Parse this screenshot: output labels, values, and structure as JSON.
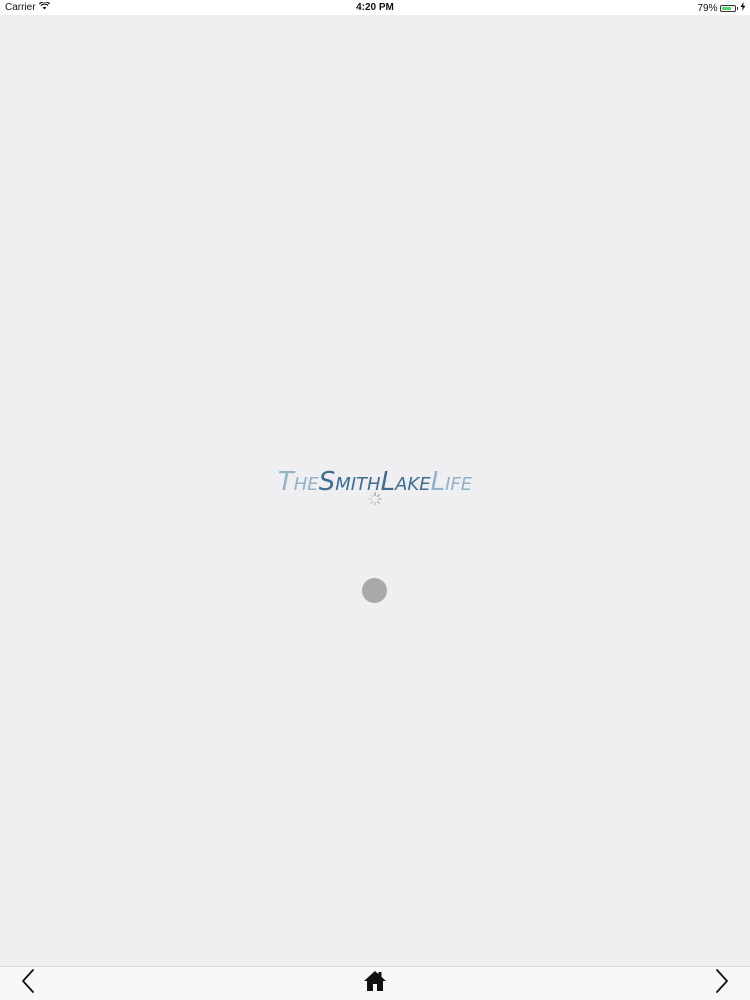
{
  "status_bar": {
    "carrier": "Carrier",
    "time": "4:20 PM",
    "battery_percent": "79%",
    "battery_level": 0.79,
    "battery_color": "#4cd964"
  },
  "logo": {
    "part1_T": "T",
    "part1_rest": "HE",
    "part2_S": "S",
    "part2_rest": "MITH",
    "part3_L": "L",
    "part3_rest": "AKE",
    "part4_L": "L",
    "part4_rest": "IFE",
    "light_color": "#8fb3c9",
    "dark_color": "#3d6e91"
  },
  "toolbar": {
    "back_icon": "chevron-left-icon",
    "home_icon": "home-icon",
    "forward_icon": "chevron-right-icon"
  }
}
